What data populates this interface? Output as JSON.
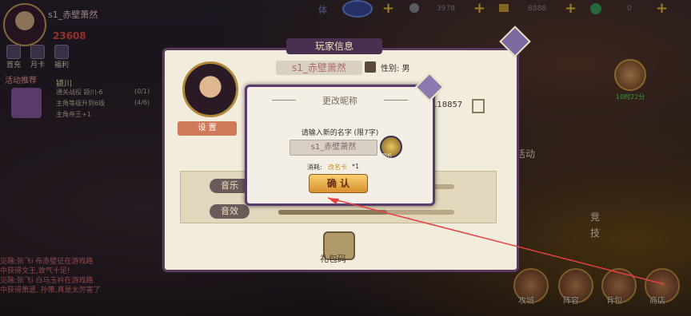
{
  "header": {
    "player_name": "s1_赤壁萧然",
    "power": "23608",
    "top_buttons": [
      "首充",
      "月卡",
      "福利"
    ],
    "event_banner": "活动推荐"
  },
  "resources": [
    {
      "label": "体",
      "value": ""
    },
    {
      "label": "",
      "value": "3978"
    },
    {
      "label": "",
      "value": "8888"
    },
    {
      "label": "",
      "value": "0"
    }
  ],
  "quest": {
    "title": "颍川",
    "lines": [
      {
        "text": "通关战役 颍川-6",
        "progress": "(0/1)"
      },
      {
        "text": "主角等级升到6级",
        "progress": "(4/6)"
      },
      {
        "text": "主角帝王+1",
        "progress": ""
      }
    ]
  },
  "chat": [
    "见融:张飞i 布赤壁征在游戏路",
    "中获得文王,致气十足!",
    "见融:张飞i 白马玉衿在游戏路",
    "中获得萧遗, 孙策,真是太厉害了"
  ],
  "right_side": {
    "timer": "10时22分",
    "huodong": "活动",
    "jingji": "竞技"
  },
  "bottom_nav": [
    "攻城",
    "阵容",
    "背包",
    "商店"
  ],
  "player_panel": {
    "title": "玩家信息",
    "name": "s1_赤壁萧然",
    "gender": "性别: 男",
    "uid": "118857",
    "settings_label": "设 置",
    "music_label": "音乐",
    "sfx_label": "音效",
    "music_level": 0.55,
    "sfx_level": 0.62,
    "gift_code_label": "礼包码"
  },
  "rename_dialog": {
    "title": "更改昵称",
    "prompt": "请输入新的名字 (限7字)",
    "input_value": "s1_赤壁萧然",
    "random_label": "随机",
    "cost_label": "消耗:",
    "cost_item": "改名卡",
    "cost_count": "*1",
    "confirm_label": "确 认"
  },
  "colors": {
    "panel_bg": "#f2ecdc",
    "panel_border": "#5a3a5a",
    "confirm_btn": "#f0b040",
    "annotation_arrow": "#e84040"
  }
}
